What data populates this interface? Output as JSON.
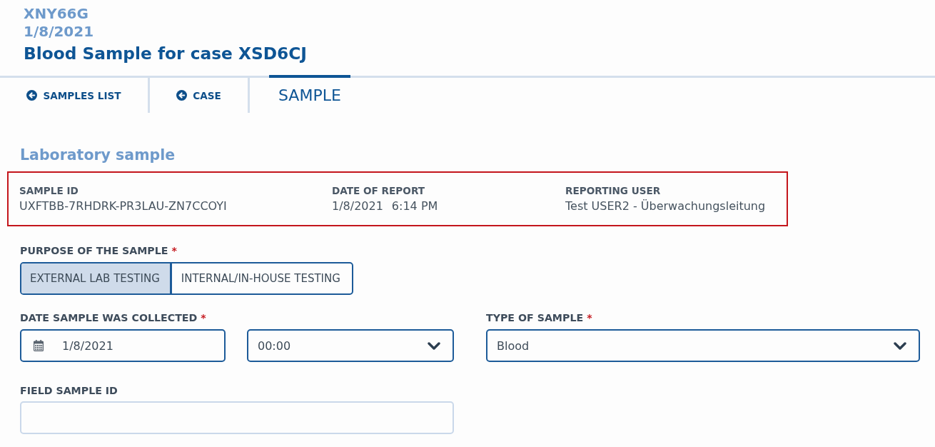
{
  "header": {
    "case_code": "XNY66G",
    "date": "1/8/2021",
    "title": "Blood Sample for case XSD6CJ"
  },
  "tabs": [
    {
      "label": "SAMPLES LIST",
      "kind": "back",
      "selected": false
    },
    {
      "label": "CASE",
      "kind": "back",
      "selected": false
    },
    {
      "label": "SAMPLE",
      "kind": "page",
      "selected": true
    }
  ],
  "section": {
    "title": "Laboratory sample",
    "report_info": [
      {
        "label": "SAMPLE ID",
        "values": [
          "UXFTBB-7RHDRK-PR3LAU-ZN7CCOYI"
        ]
      },
      {
        "label": "DATE OF REPORT",
        "values": [
          "1/8/2021",
          "6:14 PM"
        ]
      },
      {
        "label": "REPORTING USER",
        "values": [
          "Test USER2 - Überwachungsleitung"
        ]
      }
    ]
  },
  "purpose": {
    "label": "PURPOSE OF THE SAMPLE",
    "required_mark": "*",
    "options": [
      {
        "label": "EXTERNAL LAB TESTING",
        "selected": true
      },
      {
        "label": "INTERNAL/IN-HOUSE TESTING",
        "selected": false
      }
    ]
  },
  "date_collected": {
    "label": "DATE SAMPLE WAS COLLECTED",
    "required_mark": "*",
    "date": "1/8/2021",
    "time": "00:00"
  },
  "type_of_sample": {
    "label": "TYPE OF SAMPLE",
    "required_mark": "*",
    "value": "Blood"
  },
  "field_sample_id": {
    "label": "FIELD SAMPLE ID"
  }
}
